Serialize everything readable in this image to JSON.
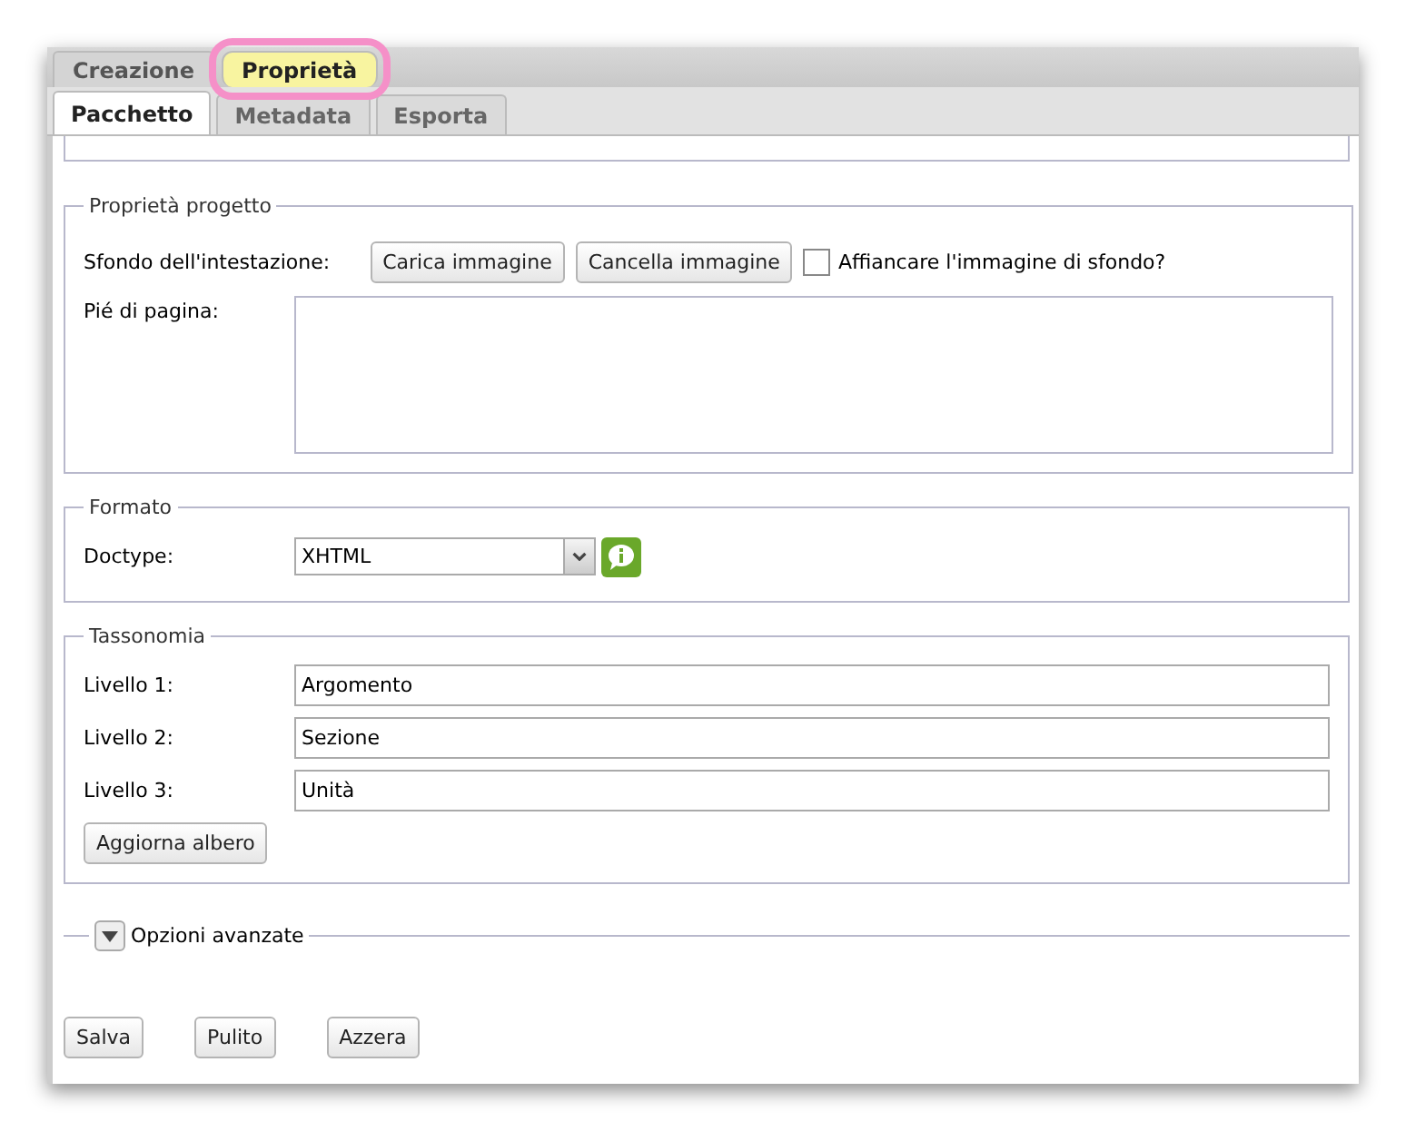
{
  "main_tabs": [
    {
      "label": "Creazione",
      "selected": false,
      "highlighted": false
    },
    {
      "label": "Proprietà",
      "selected": true,
      "highlighted": true
    }
  ],
  "sub_tabs": [
    {
      "label": "Pacchetto",
      "selected": true
    },
    {
      "label": "Metadata",
      "selected": false
    },
    {
      "label": "Esporta",
      "selected": false
    }
  ],
  "project_properties": {
    "legend": "Proprietà progetto",
    "header_background_label": "Sfondo dell'intestazione:",
    "buttons": [
      "Carica immagine",
      "Cancella immagine"
    ],
    "tile_checkbox": {
      "label": "Affiancare l'immagine di sfondo?",
      "checked": false
    },
    "footer_label": "Pié di pagina:"
  },
  "format": {
    "legend": "Formato",
    "doctype_label": "Doctype:",
    "doctype_value": "XHTML"
  },
  "taxonomy": {
    "legend": "Tassonomia",
    "levels": [
      {
        "label": "Livello 1:",
        "value": "Argomento"
      },
      {
        "label": "Livello 2:",
        "value": "Sezione"
      },
      {
        "label": "Livello 3:",
        "value": "Unità"
      }
    ],
    "update_button": "Aggiorna albero"
  },
  "advanced": {
    "label": "Opzioni avanzate",
    "expanded": false
  },
  "footer_buttons": [
    "Salva",
    "Pulito",
    "Azzera"
  ]
}
